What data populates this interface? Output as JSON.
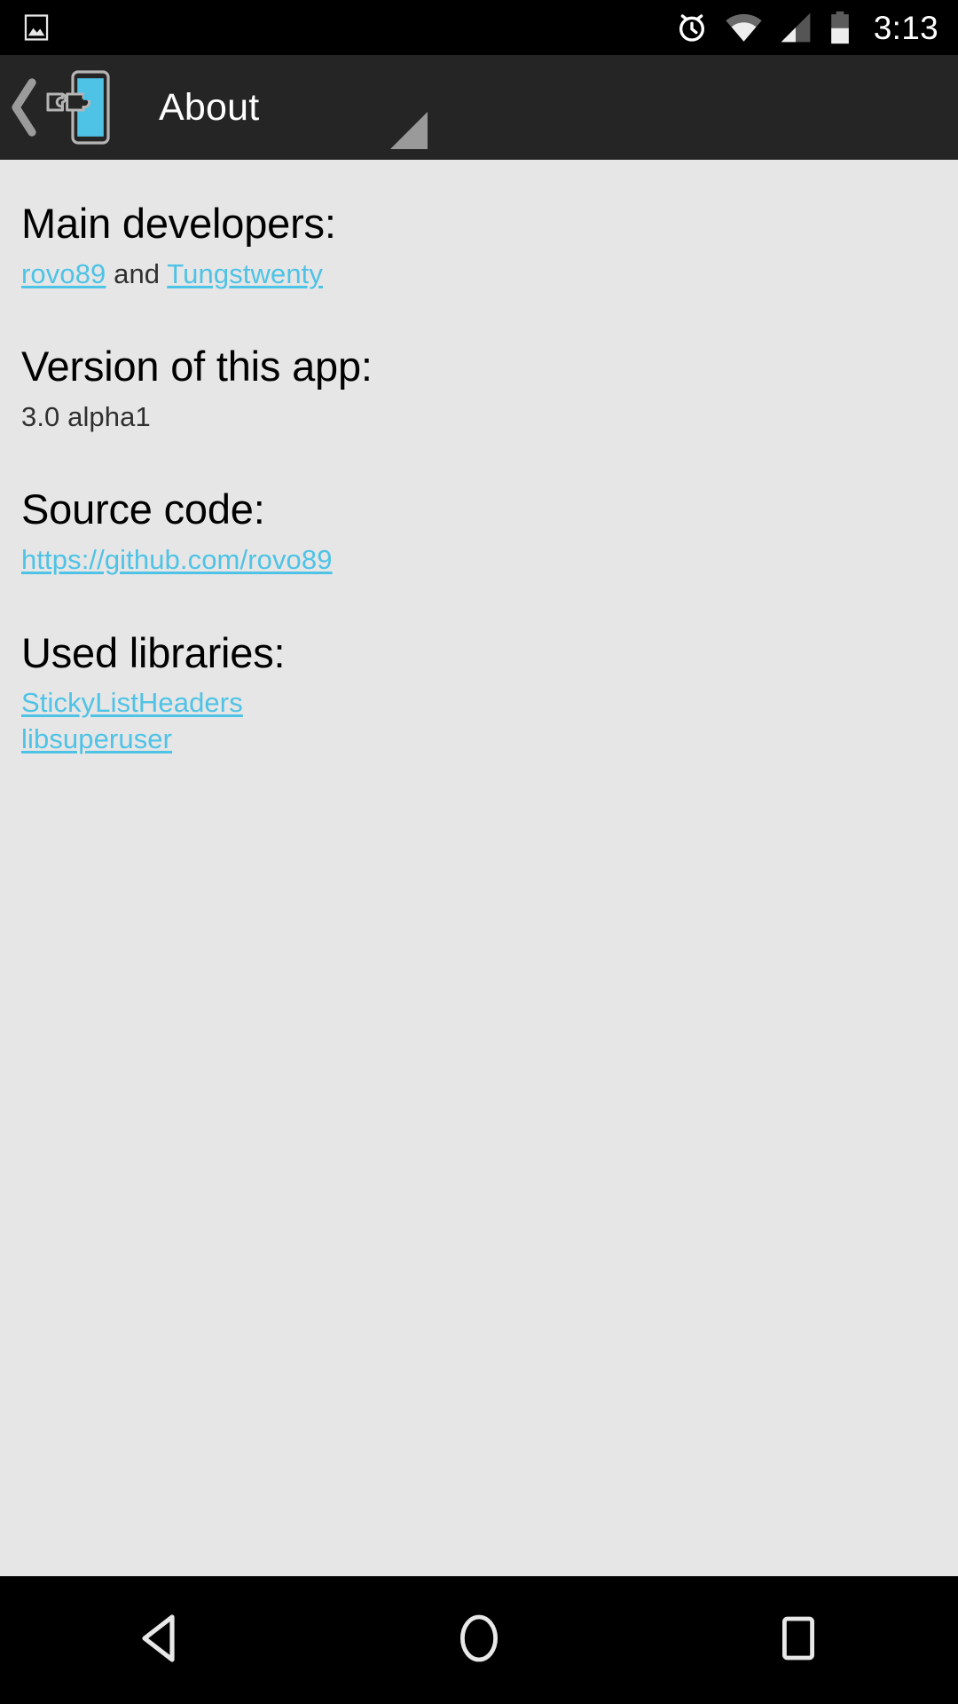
{
  "status_bar": {
    "left_icons": [
      {
        "name": "screenshot-image-icon",
        "label": "screenshot-image-icon"
      }
    ],
    "right_icons": [
      {
        "name": "alarm-clock-icon",
        "label": "alarm-clock-icon"
      },
      {
        "name": "wifi-icon",
        "label": "wifi-icon"
      },
      {
        "name": "cellular-signal-icon",
        "label": "cellular-signal-icon"
      },
      {
        "name": "battery-icon",
        "label": "battery-icon"
      }
    ],
    "clock": "3:13",
    "background_color": "#000000",
    "icon_color": "#ffffff"
  },
  "app_bar": {
    "title": "About",
    "back_icon": "back-chevron-icon",
    "app_icon": "xposed-installer-icon",
    "background_color": "#252525",
    "title_color": "#ffffff",
    "accent_color": "#4ec3e6",
    "resize_handle_icon": "resize-handle-icon"
  },
  "content": {
    "background_color": "#e6e6e6",
    "link_color": "#4ec3e6",
    "sections": [
      {
        "heading": "Main developers:",
        "dev_link_1": "rovo89",
        "dev_conjunction": " and ",
        "dev_link_2": "Tungstwenty"
      },
      {
        "heading": "Version of this app:",
        "value": "3.0 alpha1"
      },
      {
        "heading": "Source code:",
        "link": "https://github.com/rovo89"
      },
      {
        "heading": "Used libraries:",
        "library_1": "StickyListHeaders",
        "library_2": "libsuperuser"
      }
    ]
  },
  "nav_bar": {
    "background_color": "#000000",
    "buttons": [
      {
        "name": "nav-back-button",
        "icon": "back-triangle-icon"
      },
      {
        "name": "nav-home-button",
        "icon": "home-circle-icon"
      },
      {
        "name": "nav-recents-button",
        "icon": "recents-square-icon"
      }
    ]
  }
}
